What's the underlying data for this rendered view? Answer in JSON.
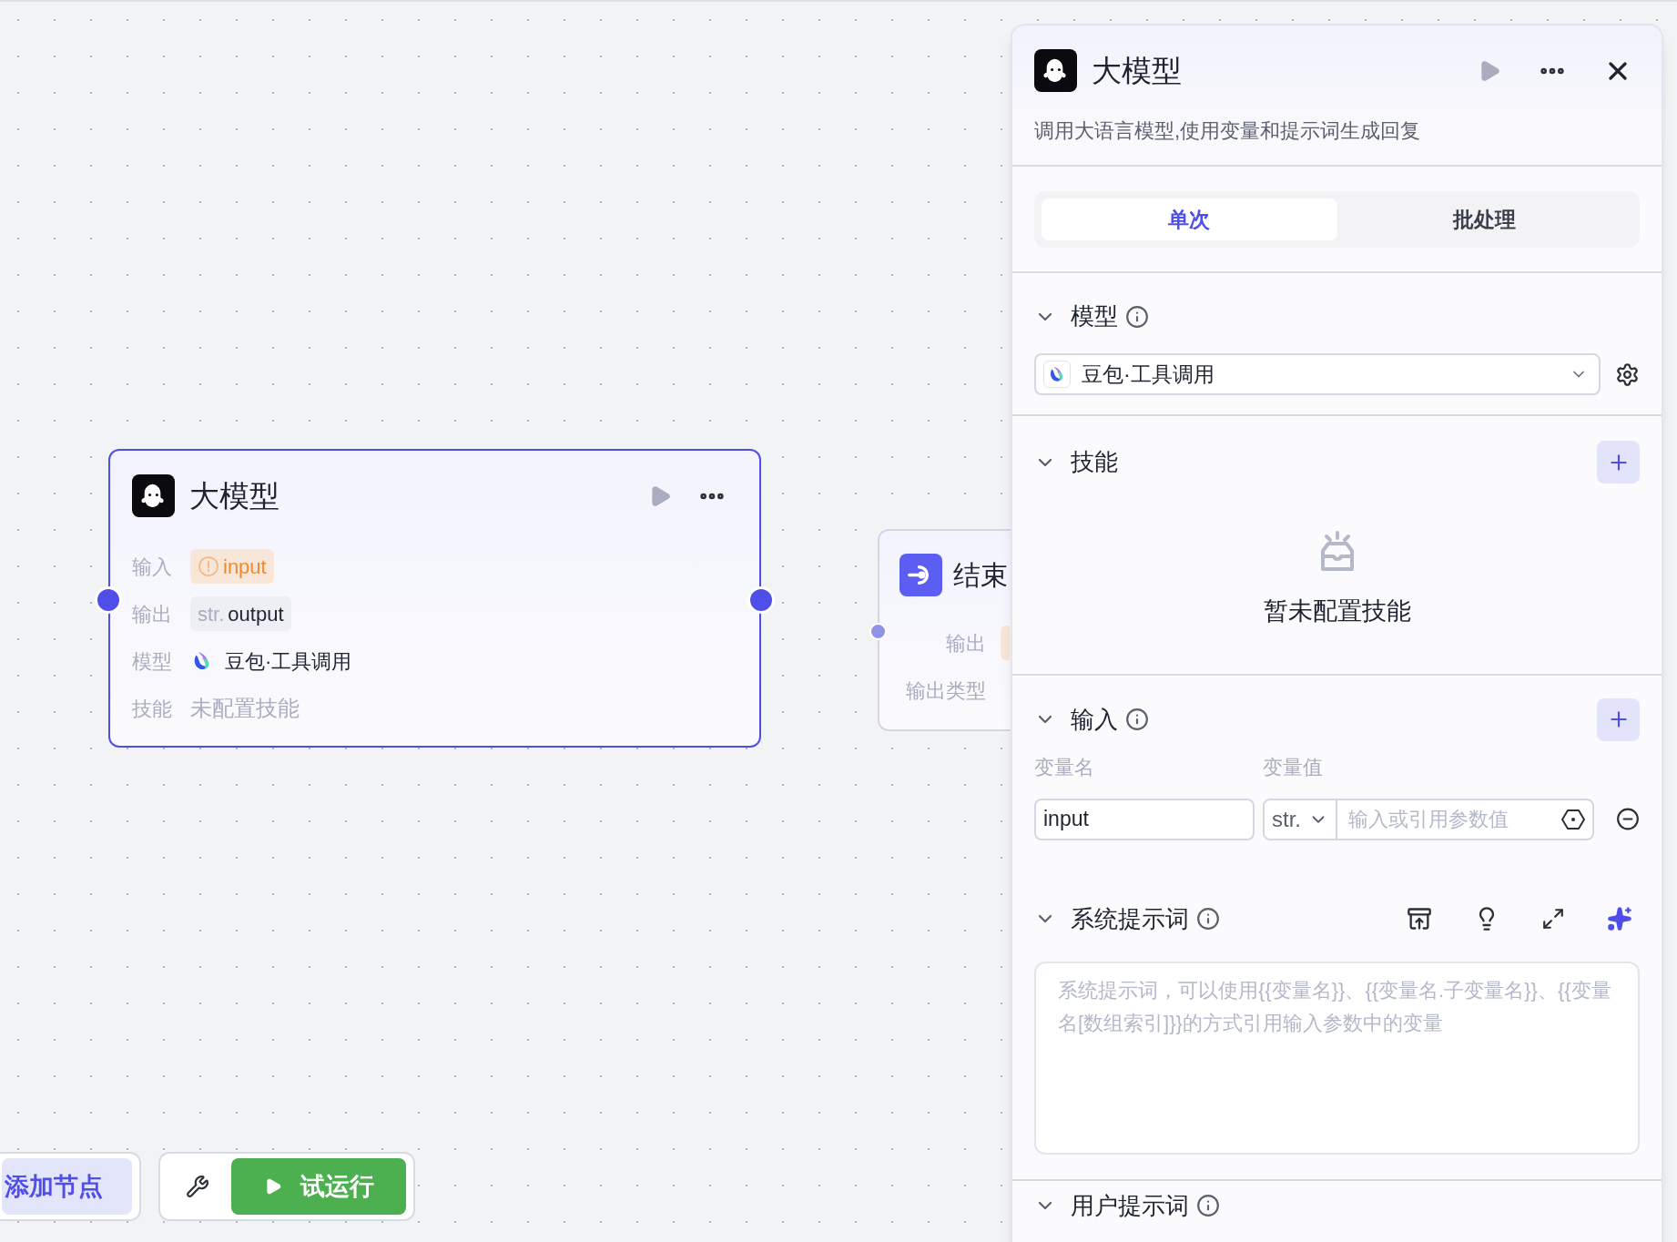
{
  "canvas": {
    "nodes": [
      {
        "kind": "llm",
        "title": "大模型",
        "selected": true,
        "rows": [
          {
            "label": "输入",
            "kind": "warning_tag",
            "value": "input"
          },
          {
            "label": "输出",
            "kind": "typed_tag",
            "type": "str.",
            "value": "output"
          },
          {
            "label": "模型",
            "kind": "model",
            "value": "豆包·工具调用"
          },
          {
            "label": "技能",
            "kind": "muted",
            "value": "未配置技能"
          }
        ]
      },
      {
        "kind": "end",
        "title": "结束",
        "selected": false,
        "rows": [
          {
            "label": "输出",
            "kind": "warning_tag"
          },
          {
            "label": "输出类型",
            "kind": "plain"
          }
        ]
      }
    ]
  },
  "panel": {
    "title": "大模型",
    "description": "调用大语言模型,使用变量和提示词生成回复",
    "tabs": [
      {
        "label": "单次",
        "selected": true
      },
      {
        "label": "批处理",
        "selected": false
      }
    ],
    "sections": [
      {
        "kind": "model",
        "title": "模型",
        "info": true,
        "expanded": true,
        "model": "豆包·工具调用"
      },
      {
        "kind": "skills",
        "title": "技能",
        "info": false,
        "expanded": true,
        "empty_text": "暂未配置技能"
      },
      {
        "kind": "inputs",
        "title": "输入",
        "info": true,
        "expanded": true,
        "columns": [
          "变量名",
          "变量值"
        ],
        "rows": [
          {
            "name": "input",
            "type": "str.",
            "placeholder": "输入或引用参数值"
          }
        ]
      },
      {
        "kind": "prompt",
        "title": "系统提示词",
        "info": true,
        "expanded": true,
        "placeholder": "系统提示词，可以使用{{变量名}}、{{变量名.子变量名}}、{{变量名[数组索引]}}的方式引用输入参数中的变量"
      },
      {
        "kind": "header",
        "title": "用户提示词",
        "info": true,
        "expanded": true
      }
    ]
  },
  "toolbar": {
    "add_node": "添加节点",
    "run": "试运行"
  }
}
